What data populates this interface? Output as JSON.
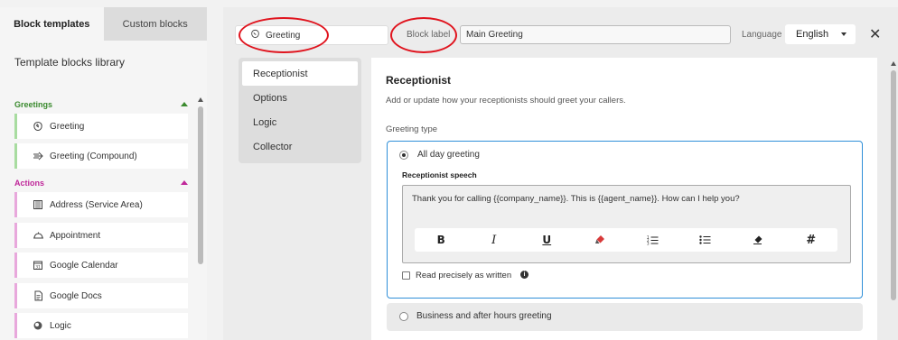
{
  "left_panel": {
    "tabs": [
      {
        "label": "Block templates",
        "active": true
      },
      {
        "label": "Custom blocks",
        "active": false
      }
    ],
    "title": "Template blocks library",
    "categories": {
      "greetings": {
        "label": "Greetings",
        "color": "#3a8a2e"
      },
      "actions": {
        "label": "Actions",
        "color": "#c0289a"
      }
    },
    "greetings_items": [
      {
        "label": "Greeting",
        "icon": "greeting-icon"
      },
      {
        "label": "Greeting (Compound)",
        "icon": "compound-greeting-icon"
      }
    ],
    "actions_items": [
      {
        "label": "Address (Service Area)",
        "icon": "address-icon"
      },
      {
        "label": "Appointment",
        "icon": "appointment-icon"
      },
      {
        "label": "Google Calendar",
        "icon": "calendar-icon"
      },
      {
        "label": "Google Docs",
        "icon": "docs-icon"
      },
      {
        "label": "Logic",
        "icon": "logic-icon"
      }
    ]
  },
  "header": {
    "block_name": "Greeting",
    "block_label_text": "Block label",
    "block_label_value": "Main Greeting",
    "language_label": "Language",
    "language_value": "English",
    "close": "✕"
  },
  "subnav": [
    {
      "label": "Receptionist",
      "active": true
    },
    {
      "label": "Options",
      "active": false
    },
    {
      "label": "Logic",
      "active": false
    },
    {
      "label": "Collector",
      "active": false
    }
  ],
  "content": {
    "title": "Receptionist",
    "description": "Add or update how your receptionists should greet your callers.",
    "greeting_type_label": "Greeting type",
    "option_all_day": "All day greeting",
    "speech_label": "Receptionist speech",
    "speech_text": "Thank you for calling {{company_name}}. This is {{agent_name}}. How can I help you?",
    "read_precisely": "Read precisely as written",
    "option_business": "Business and after hours greeting"
  },
  "colors": {
    "accent_blue": "#2f8fd8",
    "annotation_red": "#e0141e",
    "greeting_green": "#3a8a2e",
    "action_pink": "#c0289a"
  }
}
